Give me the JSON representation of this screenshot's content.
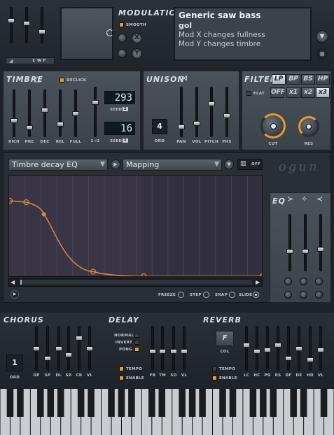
{
  "top": {
    "cwf_label": "C W F",
    "modulation_title": "MODULATION",
    "smooth_label": "SMOOTH",
    "x_label": "X",
    "y_label": "Y"
  },
  "preset": {
    "name": "Generic saw bass",
    "author": "gol",
    "desc1": "Mod X changes fullness",
    "desc2": "Mod Y changes timbre"
  },
  "timbre": {
    "title": "TIMBRE",
    "declick_label": "DECLICK",
    "seed2_value": "293",
    "seed2_label": "SEED",
    "seed2_num": "2",
    "seed1_value": "16",
    "seed1_label": "SEED",
    "seed1_num": "1",
    "link_label": "1→2",
    "sliders": [
      "RICH",
      "PRE",
      "DEC",
      "REL",
      "FULL"
    ],
    "slider_levels": [
      0.33,
      0.17,
      0.58,
      0.25,
      0.5,
      0.71
    ]
  },
  "unison": {
    "title": "UNISON",
    "ord_value": "4",
    "ord_label": "ORD",
    "sliders": [
      "PAN",
      "VOL",
      "PITCH",
      "PHS"
    ],
    "slider_levels": [
      0.17,
      0.25,
      0.67,
      0.42
    ]
  },
  "filter": {
    "title": "FILTER",
    "flat_label": "FLAT",
    "types": [
      "LP",
      "BP",
      "BS",
      "HP"
    ],
    "active_type": "LP",
    "mult": [
      "OFF",
      "x1",
      "x2",
      "x3"
    ],
    "active_mult": "x3",
    "cut_label": "CUT",
    "res_label": "RES"
  },
  "editor": {
    "target": "Timbre decay EQ",
    "mapping": "Mapping",
    "off_label": "OFF",
    "logo": "ogun",
    "freeze_label": "FREEZE",
    "step_label": "STEP",
    "snap_label": "SNAP",
    "slide_label": "SLIDE"
  },
  "eq": {
    "title": "EQ",
    "band_levels": [
      0.33,
      0.33,
      0.38
    ]
  },
  "chorus": {
    "title": "CHORUS",
    "ord_value": "1",
    "ord_label": "ORD",
    "sliders": [
      "DP",
      "SP",
      "DL",
      "SR",
      "CR",
      "VL"
    ],
    "slider_levels": [
      0.5,
      0.25,
      0.5,
      0.33,
      0.75,
      0.5
    ]
  },
  "delay": {
    "title": "DELAY",
    "modes": [
      "NORMAL",
      "INVERT",
      "PONG"
    ],
    "active_mode": "PONG",
    "tempo_label": "TEMPO",
    "enable_label": "ENABLE",
    "sliders": [
      "FB",
      "TM",
      "SO",
      "VL"
    ],
    "slider_levels": [
      0.42,
      0.42,
      0.42,
      0.42
    ]
  },
  "reverb": {
    "title": "REVERB",
    "col_value": "F",
    "col_label": "COL",
    "tempo_label": "TEMPO",
    "enable_label": "ENABLE",
    "sliders": [
      "LC",
      "HC",
      "PD",
      "RS",
      "DF",
      "DE",
      "HD",
      "VL"
    ],
    "slider_levels": [
      0.58,
      0.42,
      0.46,
      0.58,
      0.25,
      0.5,
      0.21,
      0.46
    ]
  },
  "envelope": {
    "points": [
      [
        0,
        1.0
      ],
      [
        0.065,
        0.98
      ],
      [
        0.135,
        0.82
      ],
      [
        0.33,
        0.06
      ],
      [
        0.53,
        0.0
      ],
      [
        1.0,
        0.0
      ]
    ]
  },
  "colors": {
    "accent": "#e8a020",
    "curve": "#d7874a",
    "graph_bg": "#3a3545"
  }
}
